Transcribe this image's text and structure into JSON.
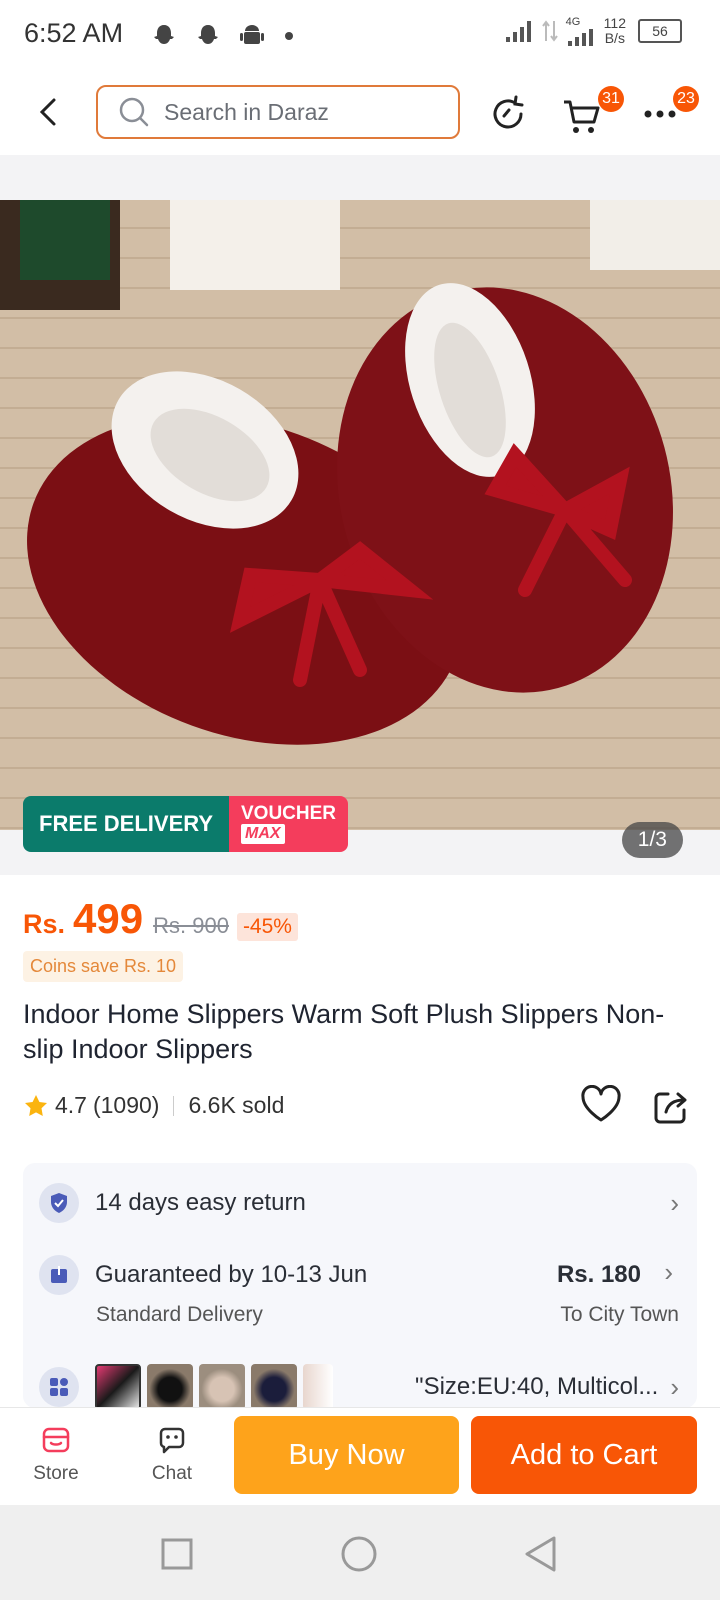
{
  "status_bar": {
    "time": "6:52 AM",
    "network": "4G",
    "speed_top": "112",
    "speed_unit": "B/s",
    "battery": "56"
  },
  "header": {
    "search_placeholder": "Search in Daraz",
    "cart_badge": "31",
    "more_badge": "23"
  },
  "gallery": {
    "free_delivery": "FREE DELIVERY",
    "voucher_line1": "VOUCHER",
    "voucher_line2": "MAX",
    "pager": "1/3"
  },
  "product": {
    "currency": "Rs.",
    "price": "499",
    "old_price": "Rs. 900",
    "discount": "-45%",
    "coins": "Coins save Rs. 10",
    "title": "Indoor Home Slippers Warm Soft Plush Slippers Non-slip Indoor Slippers",
    "rating": "4.7",
    "rating_count": "(1090)",
    "sold": "6.6K sold"
  },
  "info": {
    "return": "14 days easy return",
    "delivery_title": "Guaranteed by 10-13 Jun",
    "delivery_sub": "Standard Delivery",
    "delivery_price": "Rs. 180",
    "delivery_to": "To City Town",
    "variant": "\"Size:EU:40, Multicol..."
  },
  "bottom": {
    "store": "Store",
    "chat": "Chat",
    "buy_now": "Buy Now",
    "add_to_cart": "Add to Cart"
  },
  "colors": {
    "brand": "#f85606",
    "buy_now": "#fea31b",
    "free_delivery": "#0b7b6b",
    "voucher": "#f43d5c"
  }
}
